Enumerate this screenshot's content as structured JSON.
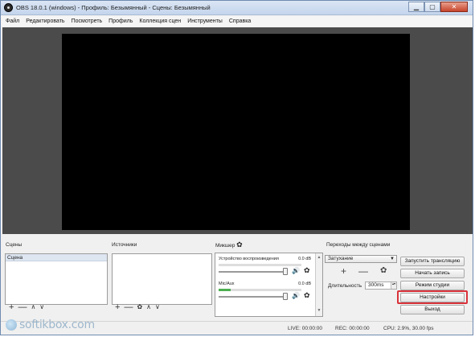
{
  "window": {
    "title": "OBS 18.0.1 (windows) - Профиль: Безымянный - Сцены: Безымянный",
    "controls": {
      "minimize": "▁",
      "maximize": "▢",
      "close": "✕"
    }
  },
  "menu": [
    "Файл",
    "Редактировать",
    "Посмотреть",
    "Профиль",
    "Коллекция сцен",
    "Инструменты",
    "Справка"
  ],
  "docks": {
    "scenes": "Сцены",
    "sources": "Источники",
    "mixer": "Микшер",
    "transitions": "Переходы между сценами"
  },
  "scenes": {
    "items": [
      "Сцена"
    ],
    "tools": {
      "add": "+",
      "remove": "—",
      "up": "∧",
      "down": "∨"
    }
  },
  "sources": {
    "tools": {
      "add": "+",
      "remove": "—",
      "settings": "✿",
      "up": "∧",
      "down": "∨"
    }
  },
  "mixer": {
    "tracks": [
      {
        "name": "Устройство воспроизведения",
        "db": "0.0 dB",
        "level": 0.0
      },
      {
        "name": "Mic/Aux",
        "db": "0.0 dB",
        "level": 0.15
      }
    ],
    "icons": {
      "volume": "🔊",
      "gear": "✿"
    },
    "scroll": {
      "up": "▲",
      "down": "▼"
    }
  },
  "transitions": {
    "selected": "Затухание",
    "arrow": "▼",
    "tools": {
      "add": "+",
      "remove": "—",
      "settings": "✿"
    },
    "duration_label": "Длительность",
    "duration_value": "300ms",
    "spin": "▴▾"
  },
  "controls": {
    "start_stream": "Запустить трансляцию",
    "start_record": "Начать запись",
    "studio_mode": "Режим студии",
    "settings": "Настройки",
    "exit": "Выход"
  },
  "status": {
    "live": "LIVE: 00:00:00",
    "rec": "REC: 00:00:00",
    "cpu": "CPU: 2.9%, 30.00 fps"
  },
  "watermark": "softikbox.com",
  "colors": {
    "highlight": "#d9323a",
    "meter": "#4caf50",
    "preview": "#000000"
  }
}
